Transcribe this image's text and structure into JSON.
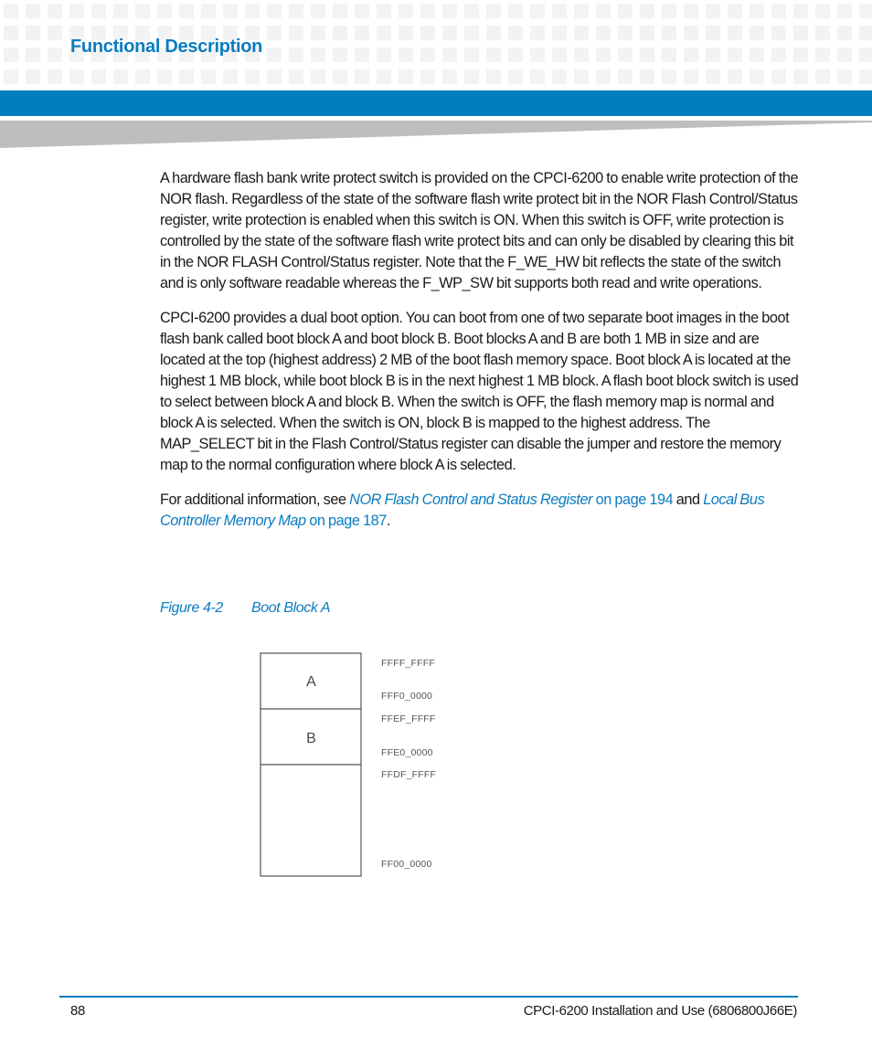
{
  "header": {
    "section_title": "Functional Description"
  },
  "body": {
    "paragraphs": [
      "A hardware flash bank write protect switch is provided on the CPCI-6200 to enable write protection of the NOR flash. Regardless of the state of the software flash write protect bit in the NOR Flash Control/Status register, write protection is enabled when this switch is ON. When this switch is OFF, write protection is controlled by the state of the software flash write protect bits and can only be disabled by clearing this bit in the NOR FLASH Control/Status register. Note that the F_WE_HW bit reflects the state of the switch and is only software readable whereas the F_WP_SW bit supports both read and write operations.",
      "CPCI-6200 provides a dual boot option. You can boot from one of two separate boot images in the boot flash bank called boot block A and boot block B. Boot blocks A and B are both 1 MB in size and are located at the top (highest address) 2 MB of the boot flash memory space. Boot block A is located at the highest 1 MB block, while boot block B is in the next highest 1 MB block. A flash boot block switch is used to select between block A and block B. When the switch is OFF, the flash memory map is normal and block A is selected. When the switch is ON, block B is mapped to the highest address. The MAP_SELECT bit in the Flash Control/Status register can disable the jumper and restore the memory map to the normal configuration where block A is selected."
    ],
    "reference": {
      "prefix": "For additional information, see ",
      "link1_title": "NOR Flash Control and Status Register",
      "link1_page": " on page 194",
      "middle": " and ",
      "link2_title": "Local Bus Controller Memory Map",
      "link2_page": " on page 187",
      "suffix": "."
    }
  },
  "figure": {
    "number": "Figure 4-2",
    "title": "Boot Block A",
    "blocks": [
      {
        "label": "A",
        "top_address": "FFFF_FFFF",
        "bottom_address": "FFF0_0000"
      },
      {
        "label": "B",
        "top_address": "FFEF_FFFF",
        "bottom_address": "FFE0_0000"
      },
      {
        "label": "",
        "top_address": "FFDF_FFFF",
        "bottom_address": "FF00_0000"
      }
    ]
  },
  "footer": {
    "page_number": "88",
    "document_ref": "CPCI-6200 Installation and Use (6806800J66E)"
  }
}
